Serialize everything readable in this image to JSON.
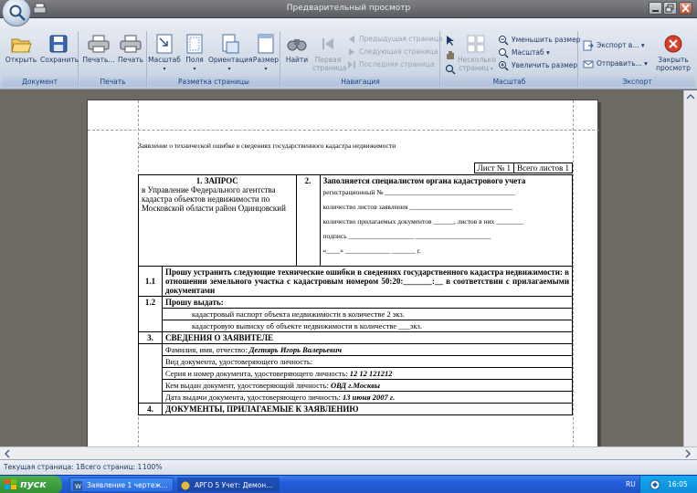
{
  "window": {
    "title": "Предварительный просмотр"
  },
  "ribbon": {
    "groups": [
      {
        "label": "Документ"
      },
      {
        "label": "Печать"
      },
      {
        "label": "Разметка страницы"
      },
      {
        "label": "Навигация"
      },
      {
        "label": "Масштаб"
      },
      {
        "label": "Экспорт"
      }
    ],
    "buttons": {
      "open": "Открыть",
      "save": "Сохранить",
      "print_dots": "Печать...",
      "print": "Печать",
      "scale": "Масштаб",
      "fields": "Поля",
      "orientation": "Ориентация",
      "size": "Размер",
      "find": "Найти",
      "first_page_1": "Первая",
      "first_page_2": "страница",
      "prev_page": "Предыдущая страница",
      "next_page": "Следующая страница",
      "last_page": "Последняя страница",
      "multi_pages_1": "Несколько",
      "multi_pages_2": "страниц",
      "zoom_out": "Уменьшить размер",
      "zoom": "Масштаб",
      "zoom_in": "Увеличить размер",
      "export": "Экспорт в...",
      "send": "Отправить...",
      "close_1": "Закрыть",
      "close_2": "просмотр"
    }
  },
  "document": {
    "header": "Заявление о технической ошибке в сведениях государственного кадастра недвижимости",
    "sheet": "Лист № 1",
    "sheets_total": "Всего листов 1",
    "s1_title": "1. ЗАПРОС",
    "s1_body": "в Управление Федерального агентства кадастра объектов недвижимости по Московской области район Одинцовский",
    "s2_num": "2.",
    "s2_title": "Заполняется специалистом органа кадастрового учета",
    "s2_reg": "регистрационный №",
    "s2_sheets": "количество листов заявления",
    "s2_docs": "количество прилагаемых документов ______, листов в них ________",
    "s2_sign": "подпись",
    "s2_date": "«____» _____________ _______ г.",
    "r11_num": "1.1",
    "r11_text": "Прошу устранить следующие технические ошибки в сведениях государственного кадастра недвижимости: в отношении земельного участка с кадастровым номером 50:20:_______:__ в соответствии с прилагаемыми документами",
    "r12_num": "1.2",
    "r12_text": "Прошу выдать:",
    "r12_a": "кадастровый  паспорт объекта недвижимости в количестве 2 экз.",
    "r12_b": "кадастровую выписку об объекте недвижимости в количестве ___экз.",
    "r3_num": "3.",
    "r3_title": "СВЕДЕНИЯ О ЗАЯВИТЕЛЕ",
    "fio_label": "Фамилия, имя, отчество:",
    "fio_value": "Дегтярь Игорь Валерьевич",
    "doc_type_label": "Вид документа, удостоверяющего личность:",
    "doc_num_label": "Серия и номер документа, удостоверяющего личность:",
    "doc_num_value": "12 12 121212",
    "issued_label": "Кем выдан документ, удостоверяющий личность:",
    "issued_value": "ОВД г.Москвы",
    "issue_date_label": "Дата выдачи документа, удостоверяющего личность:",
    "issue_date_value": "13 июня 2007 г.",
    "r4_num": "4.",
    "r4_title": "ДОКУМЕНТЫ, ПРИЛАГАЕМЫЕ К ЗАЯВЛЕНИЮ"
  },
  "status": {
    "current_page": "Текущая страница: 1",
    "total_pages": "Всего страниц: 1",
    "zoom": "100%"
  },
  "taskbar": {
    "start": "пуск",
    "task1": "Заявление 1 чертеж...",
    "task2": "АРГО 5 Учет: Демон...",
    "lang": "RU",
    "time": "16:05"
  }
}
